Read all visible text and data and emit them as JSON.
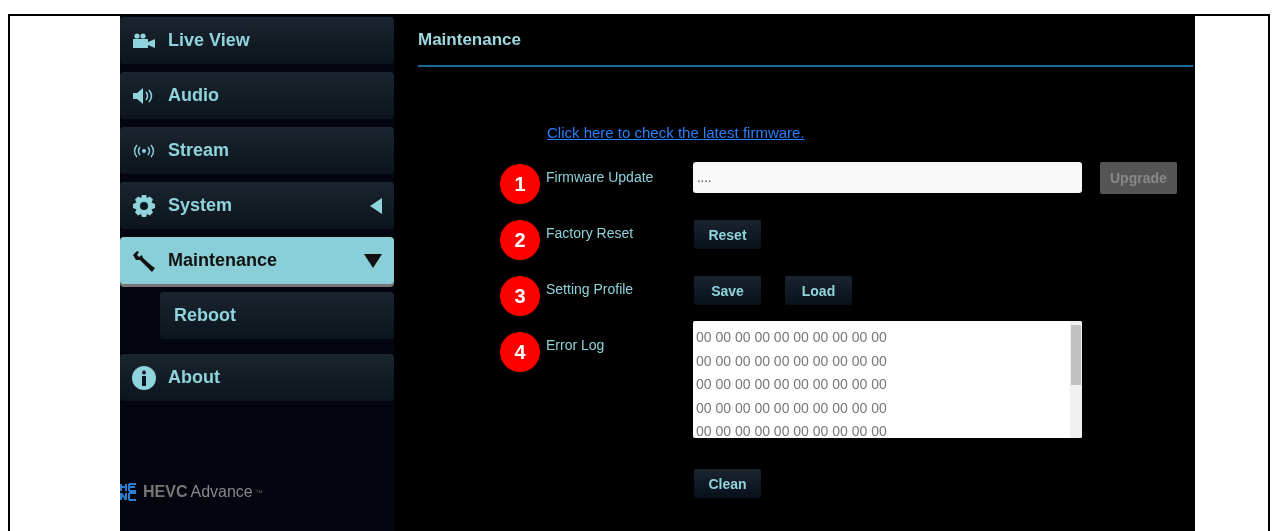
{
  "sidebar": {
    "items": [
      {
        "label": "Live View",
        "kind": "camera",
        "selected": false
      },
      {
        "label": "Audio",
        "kind": "speaker",
        "selected": false
      },
      {
        "label": "Stream",
        "kind": "broadcast",
        "selected": false
      },
      {
        "label": "System",
        "kind": "gear",
        "selected": false,
        "expanded": false
      },
      {
        "label": "Maintenance",
        "kind": "wrench",
        "selected": true,
        "expanded": true,
        "children": [
          {
            "label": "Reboot",
            "selected": false
          }
        ]
      },
      {
        "label": "About",
        "kind": "info",
        "selected": false
      }
    ],
    "logo": {
      "mark": "HEVC",
      "word": "Advance",
      "tm": "™"
    }
  },
  "panel": {
    "title": "Maintenance",
    "link": "Click here to check the latest firmware.",
    "rows": [
      {
        "number": "1",
        "label": "Firmware Update",
        "kind": "file",
        "value": "....",
        "buttons": [
          {
            "label": "Upgrade",
            "disabled": true
          }
        ]
      },
      {
        "number": "2",
        "label": "Factory Reset",
        "kind": "buttons",
        "buttons": [
          {
            "label": "Reset",
            "disabled": false
          }
        ]
      },
      {
        "number": "3",
        "label": "Setting Profile",
        "kind": "buttons",
        "buttons": [
          {
            "label": "Save",
            "disabled": false
          },
          {
            "label": "Load",
            "disabled": false
          }
        ]
      },
      {
        "number": "4",
        "label": "Error Log",
        "kind": "log",
        "lines": [
          "00 00 00 00 00 00 00 00 00 00",
          "00 00 00 00 00 00 00 00 00 00",
          "00 00 00 00 00 00 00 00 00 00",
          "00 00 00 00 00 00 00 00 00 00",
          "00 00 00 00 00 00 00 00 00 00"
        ],
        "buttons": [
          {
            "label": "Clean",
            "disabled": false
          }
        ]
      }
    ]
  }
}
